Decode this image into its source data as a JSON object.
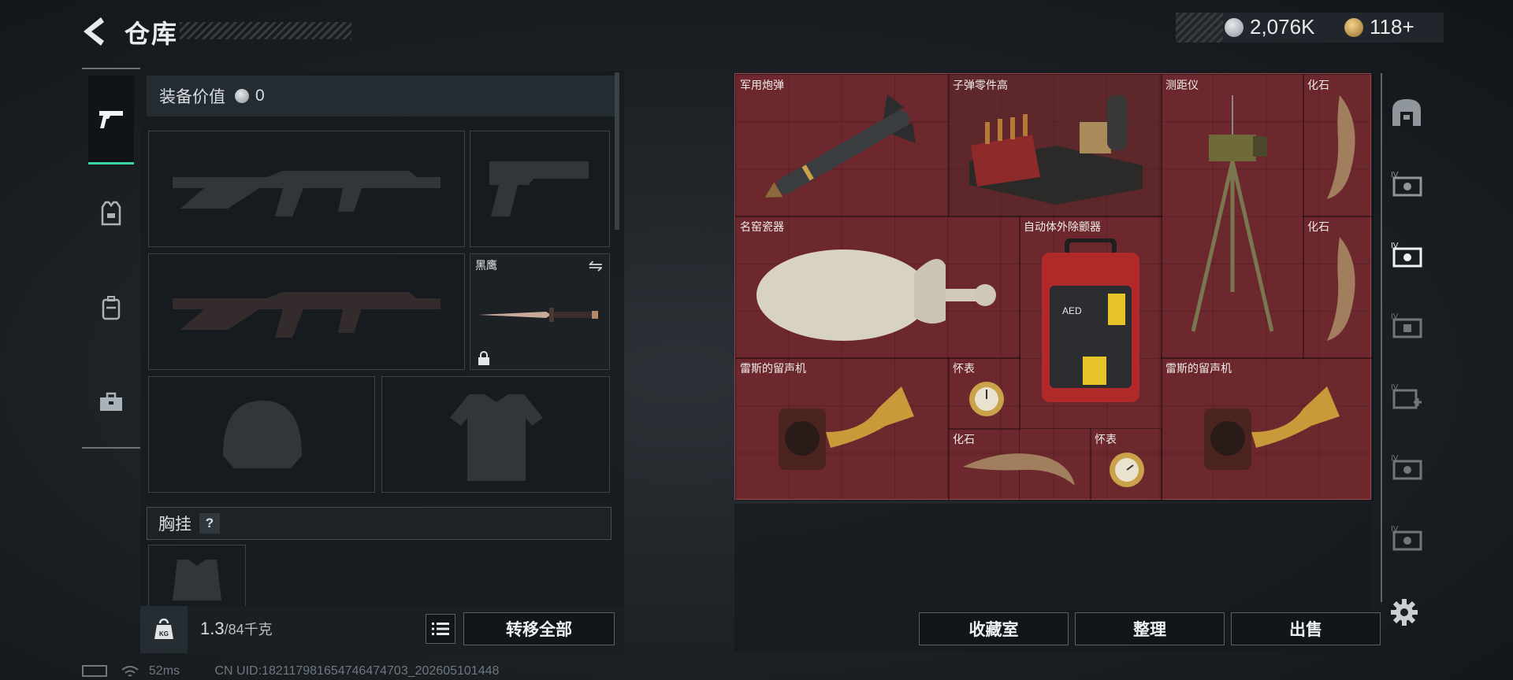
{
  "header": {
    "title": "仓库",
    "currency_silver": "2,076K",
    "currency_gold": "118+",
    "colors": {
      "silver_coin": "#b9c0c6",
      "gold_coin": "#c9a155"
    }
  },
  "equipment": {
    "value_label": "装备价值",
    "value_amount": "0",
    "knife_slot_label": "黑鹰",
    "chest_rig_label": "胸挂",
    "chest_rig_help": "?",
    "weight_current": "1.3",
    "weight_max": "/84千克",
    "transfer_all_label": "转移全部"
  },
  "storage": {
    "items": [
      {
        "label": "军用炮弹"
      },
      {
        "label": "子弹零件高"
      },
      {
        "label": "测距仪"
      },
      {
        "label": "化石"
      },
      {
        "label": "名窑瓷器"
      },
      {
        "label": "自动体外除颤器"
      },
      {
        "label": "化石"
      },
      {
        "label": "雷斯的留声机"
      },
      {
        "label": "怀表"
      },
      {
        "label": "雷斯的留声机"
      },
      {
        "label": "化石"
      },
      {
        "label": "怀表"
      }
    ],
    "colors": {
      "grid_bg": "#6c282d",
      "grid_border": "#9a4a50"
    },
    "buttons": {
      "collection": "收藏室",
      "organize": "整理",
      "sell": "出售"
    }
  },
  "status": {
    "ping": "52ms",
    "uid": "CN UID:182117981654746474703_202605101448"
  },
  "accent": "#3cd7a6"
}
